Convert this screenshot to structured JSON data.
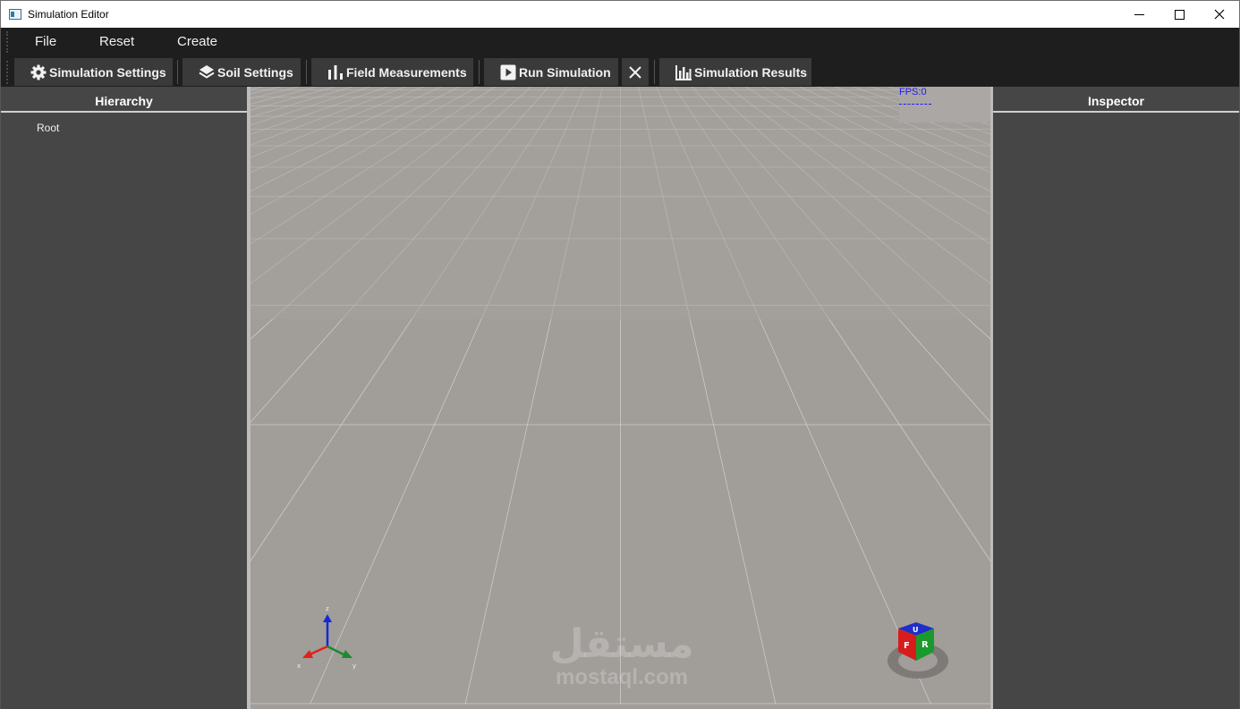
{
  "window": {
    "title": "Simulation Editor"
  },
  "menubar": {
    "items": [
      "File",
      "Reset",
      "Create"
    ]
  },
  "toolbar": {
    "buttons": [
      {
        "label": "Simulation Settings",
        "icon": "gear-icon"
      },
      {
        "label": "Soil Settings",
        "icon": "layers-icon"
      },
      {
        "label": "Field Measurements",
        "icon": "bar-chart-icon"
      },
      {
        "label": "Run Simulation",
        "icon": "play-icon"
      },
      {
        "label": "Simulation Results",
        "icon": "column-chart-icon"
      }
    ],
    "close_icon": "close-icon"
  },
  "hierarchy": {
    "title": "Hierarchy",
    "items": [
      "Root"
    ]
  },
  "inspector": {
    "title": "Inspector"
  },
  "viewport": {
    "fps": "FPS:0",
    "axes_labels": {
      "z": "z",
      "x": "x",
      "y": "y"
    },
    "cube_faces": {
      "front": "F",
      "right": "R",
      "top": "U"
    },
    "background_color": "#a19d99",
    "watermark": {
      "arabic": "مستقل",
      "latin": "mostaql.com"
    }
  },
  "colors": {
    "x_axis": "#e0221b",
    "y_axis": "#1a8a2e",
    "z_axis": "#1428d6",
    "fps_text": "#1a1aff"
  }
}
